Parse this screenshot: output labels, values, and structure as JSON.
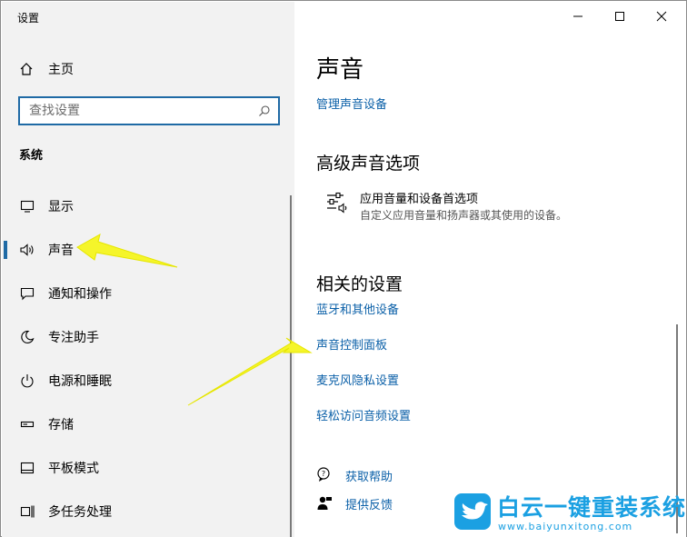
{
  "window": {
    "title": "设置"
  },
  "sidebar": {
    "home_label": "主页",
    "search_placeholder": "查找设置",
    "section_label": "系统",
    "items": [
      {
        "label": "显示",
        "icon": "monitor-icon"
      },
      {
        "label": "声音",
        "icon": "speaker-icon",
        "active": true
      },
      {
        "label": "通知和操作",
        "icon": "notification-icon"
      },
      {
        "label": "专注助手",
        "icon": "moon-icon"
      },
      {
        "label": "电源和睡眠",
        "icon": "power-icon"
      },
      {
        "label": "存储",
        "icon": "storage-icon"
      },
      {
        "label": "平板模式",
        "icon": "tablet-icon"
      },
      {
        "label": "多任务处理",
        "icon": "multitask-icon"
      }
    ]
  },
  "content": {
    "title": "声音",
    "manage_link": "管理声音设备",
    "advanced_heading": "高级声音选项",
    "app_volume_title": "应用音量和设备首选项",
    "app_volume_desc": "自定义应用音量和扬声器或其使用的设备。",
    "related_heading": "相关的设置",
    "related_links": [
      "蓝牙和其他设备",
      "声音控制面板",
      "麦克风隐私设置",
      "轻松访问音频设置"
    ],
    "help_label": "获取帮助",
    "feedback_label": "提供反馈"
  },
  "watermark": {
    "text": "白云一键重装系统",
    "url": "www.baiyunxitong.com"
  },
  "colors": {
    "accent": "#1f6aa5",
    "link": "#0b60a8",
    "arrow": "#f5f52a",
    "watermark": "#1ba0e2"
  }
}
